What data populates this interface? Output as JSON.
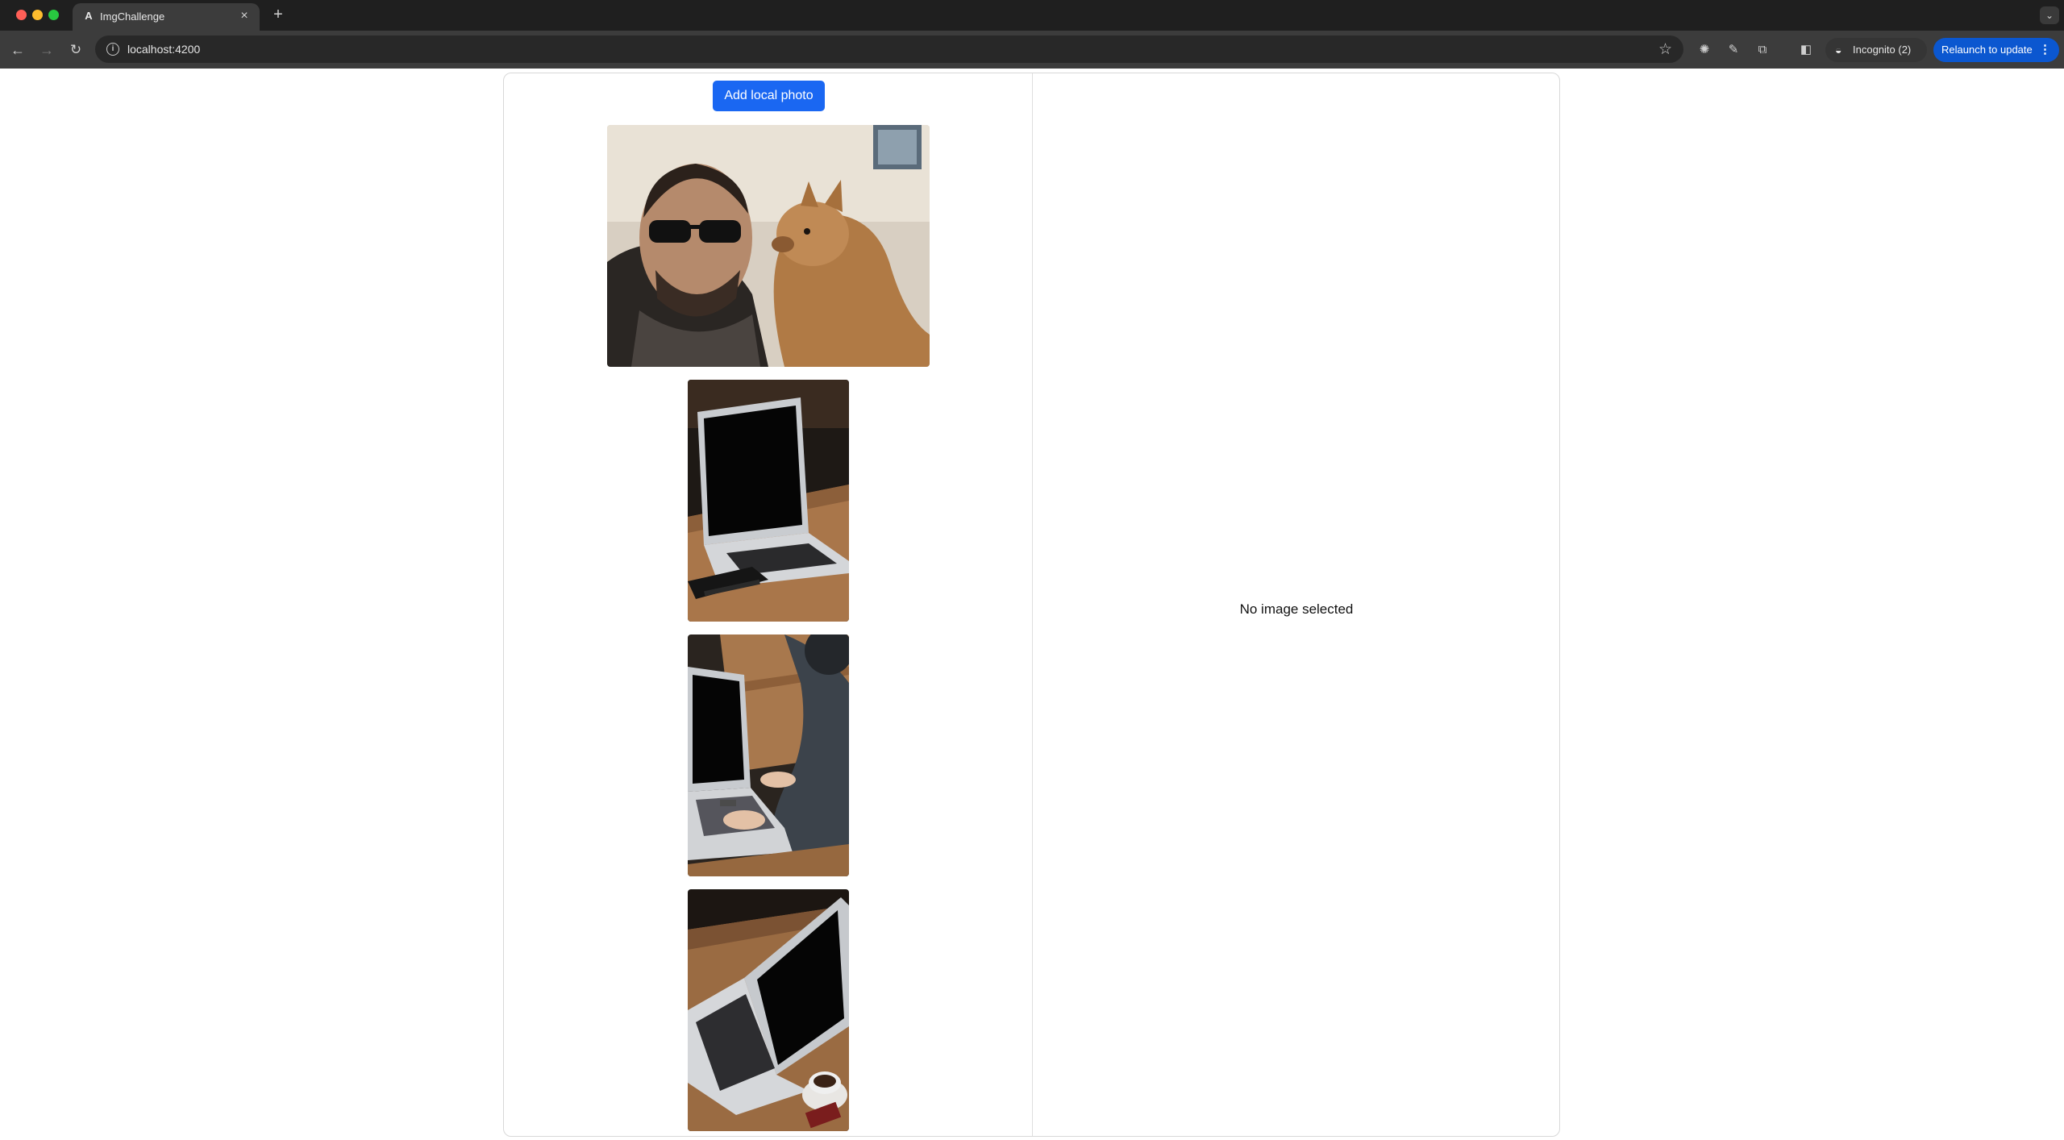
{
  "browser": {
    "tab": {
      "title": "ImgChallenge",
      "favicon": "A"
    },
    "address_bar": {
      "url": "localhost:4200"
    },
    "incognito_label": "Incognito (2)",
    "relaunch_label": "Relaunch to update"
  },
  "app": {
    "add_photo_label": "Add local photo",
    "empty_message": "No image selected",
    "photos": [
      {
        "subject": "man-with-alpaca"
      },
      {
        "subject": "laptop-on-desk"
      },
      {
        "subject": "person-typing-on-laptop"
      },
      {
        "subject": "laptop-with-coffee"
      }
    ]
  },
  "colors": {
    "primary_button": "#1a67f2",
    "relaunch_button": "#0b57d0",
    "tabstrip": "#1f1f1f",
    "toolbar": "#3c3c3c"
  }
}
